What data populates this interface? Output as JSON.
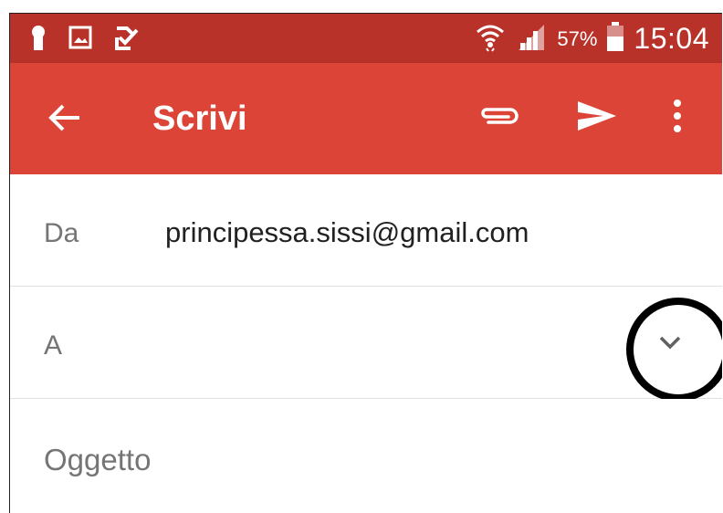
{
  "status_bar": {
    "battery_percent": "57%",
    "time": "15:04",
    "left_icons": [
      "keyhole-icon",
      "image-icon",
      "checklist-icon"
    ],
    "right_icons": [
      "wifi-icon",
      "signal-icon",
      "battery-icon"
    ]
  },
  "app_bar": {
    "title": "Scrivi",
    "color": "#db4437",
    "back_icon": "arrow-back-icon",
    "actions": [
      "attach-icon",
      "send-icon",
      "more-vert-icon"
    ]
  },
  "compose": {
    "from_label": "Da",
    "from_value": "principessa.sissi@gmail.com",
    "to_label": "A",
    "to_value": "",
    "expand_icon": "chevron-down-icon",
    "subject_placeholder": "Oggetto"
  },
  "annotation": {
    "shape": "circle",
    "target": "chevron-down-icon"
  }
}
